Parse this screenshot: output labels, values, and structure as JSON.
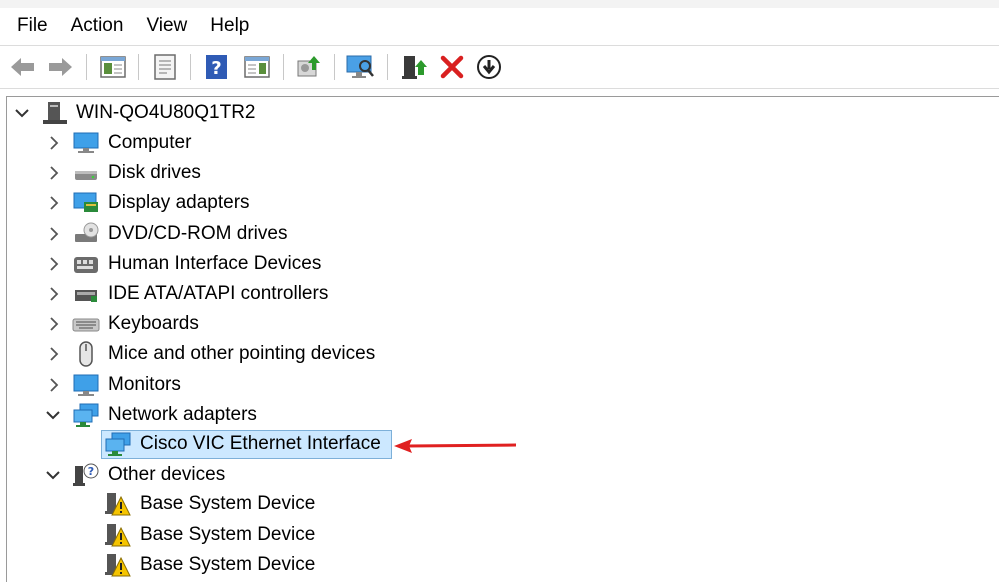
{
  "menu": [
    "File",
    "Action",
    "View",
    "Help"
  ],
  "toolbar": {
    "icons": [
      "back-arrow-icon",
      "forward-arrow-icon",
      "show-hide-console-tree-icon",
      "properties-icon",
      "help-icon",
      "action-pane-icon",
      "update-driver-icon",
      "scan-hardware-icon",
      "enable-device-icon",
      "uninstall-icon",
      "disable-device-icon"
    ]
  },
  "tree": {
    "root": "WIN-QO4U80Q1TR2",
    "categories": [
      {
        "label": "Computer",
        "expanded": false
      },
      {
        "label": "Disk drives",
        "expanded": false
      },
      {
        "label": "Display adapters",
        "expanded": false
      },
      {
        "label": "DVD/CD-ROM drives",
        "expanded": false
      },
      {
        "label": "Human Interface Devices",
        "expanded": false
      },
      {
        "label": "IDE ATA/ATAPI controllers",
        "expanded": false
      },
      {
        "label": "Keyboards",
        "expanded": false
      },
      {
        "label": "Mice and other pointing devices",
        "expanded": false
      },
      {
        "label": "Monitors",
        "expanded": false
      },
      {
        "label": "Network adapters",
        "expanded": true,
        "children": [
          {
            "label": "Cisco VIC Ethernet Interface",
            "selected": true
          }
        ]
      },
      {
        "label": "Other devices",
        "expanded": true,
        "children": [
          {
            "label": "Base System Device",
            "warning": true
          },
          {
            "label": "Base System Device",
            "warning": true
          },
          {
            "label": "Base System Device",
            "warning": true
          }
        ]
      }
    ]
  },
  "colors": {
    "selection": "#cce8ff",
    "annotation_arrow": "#e02020"
  }
}
